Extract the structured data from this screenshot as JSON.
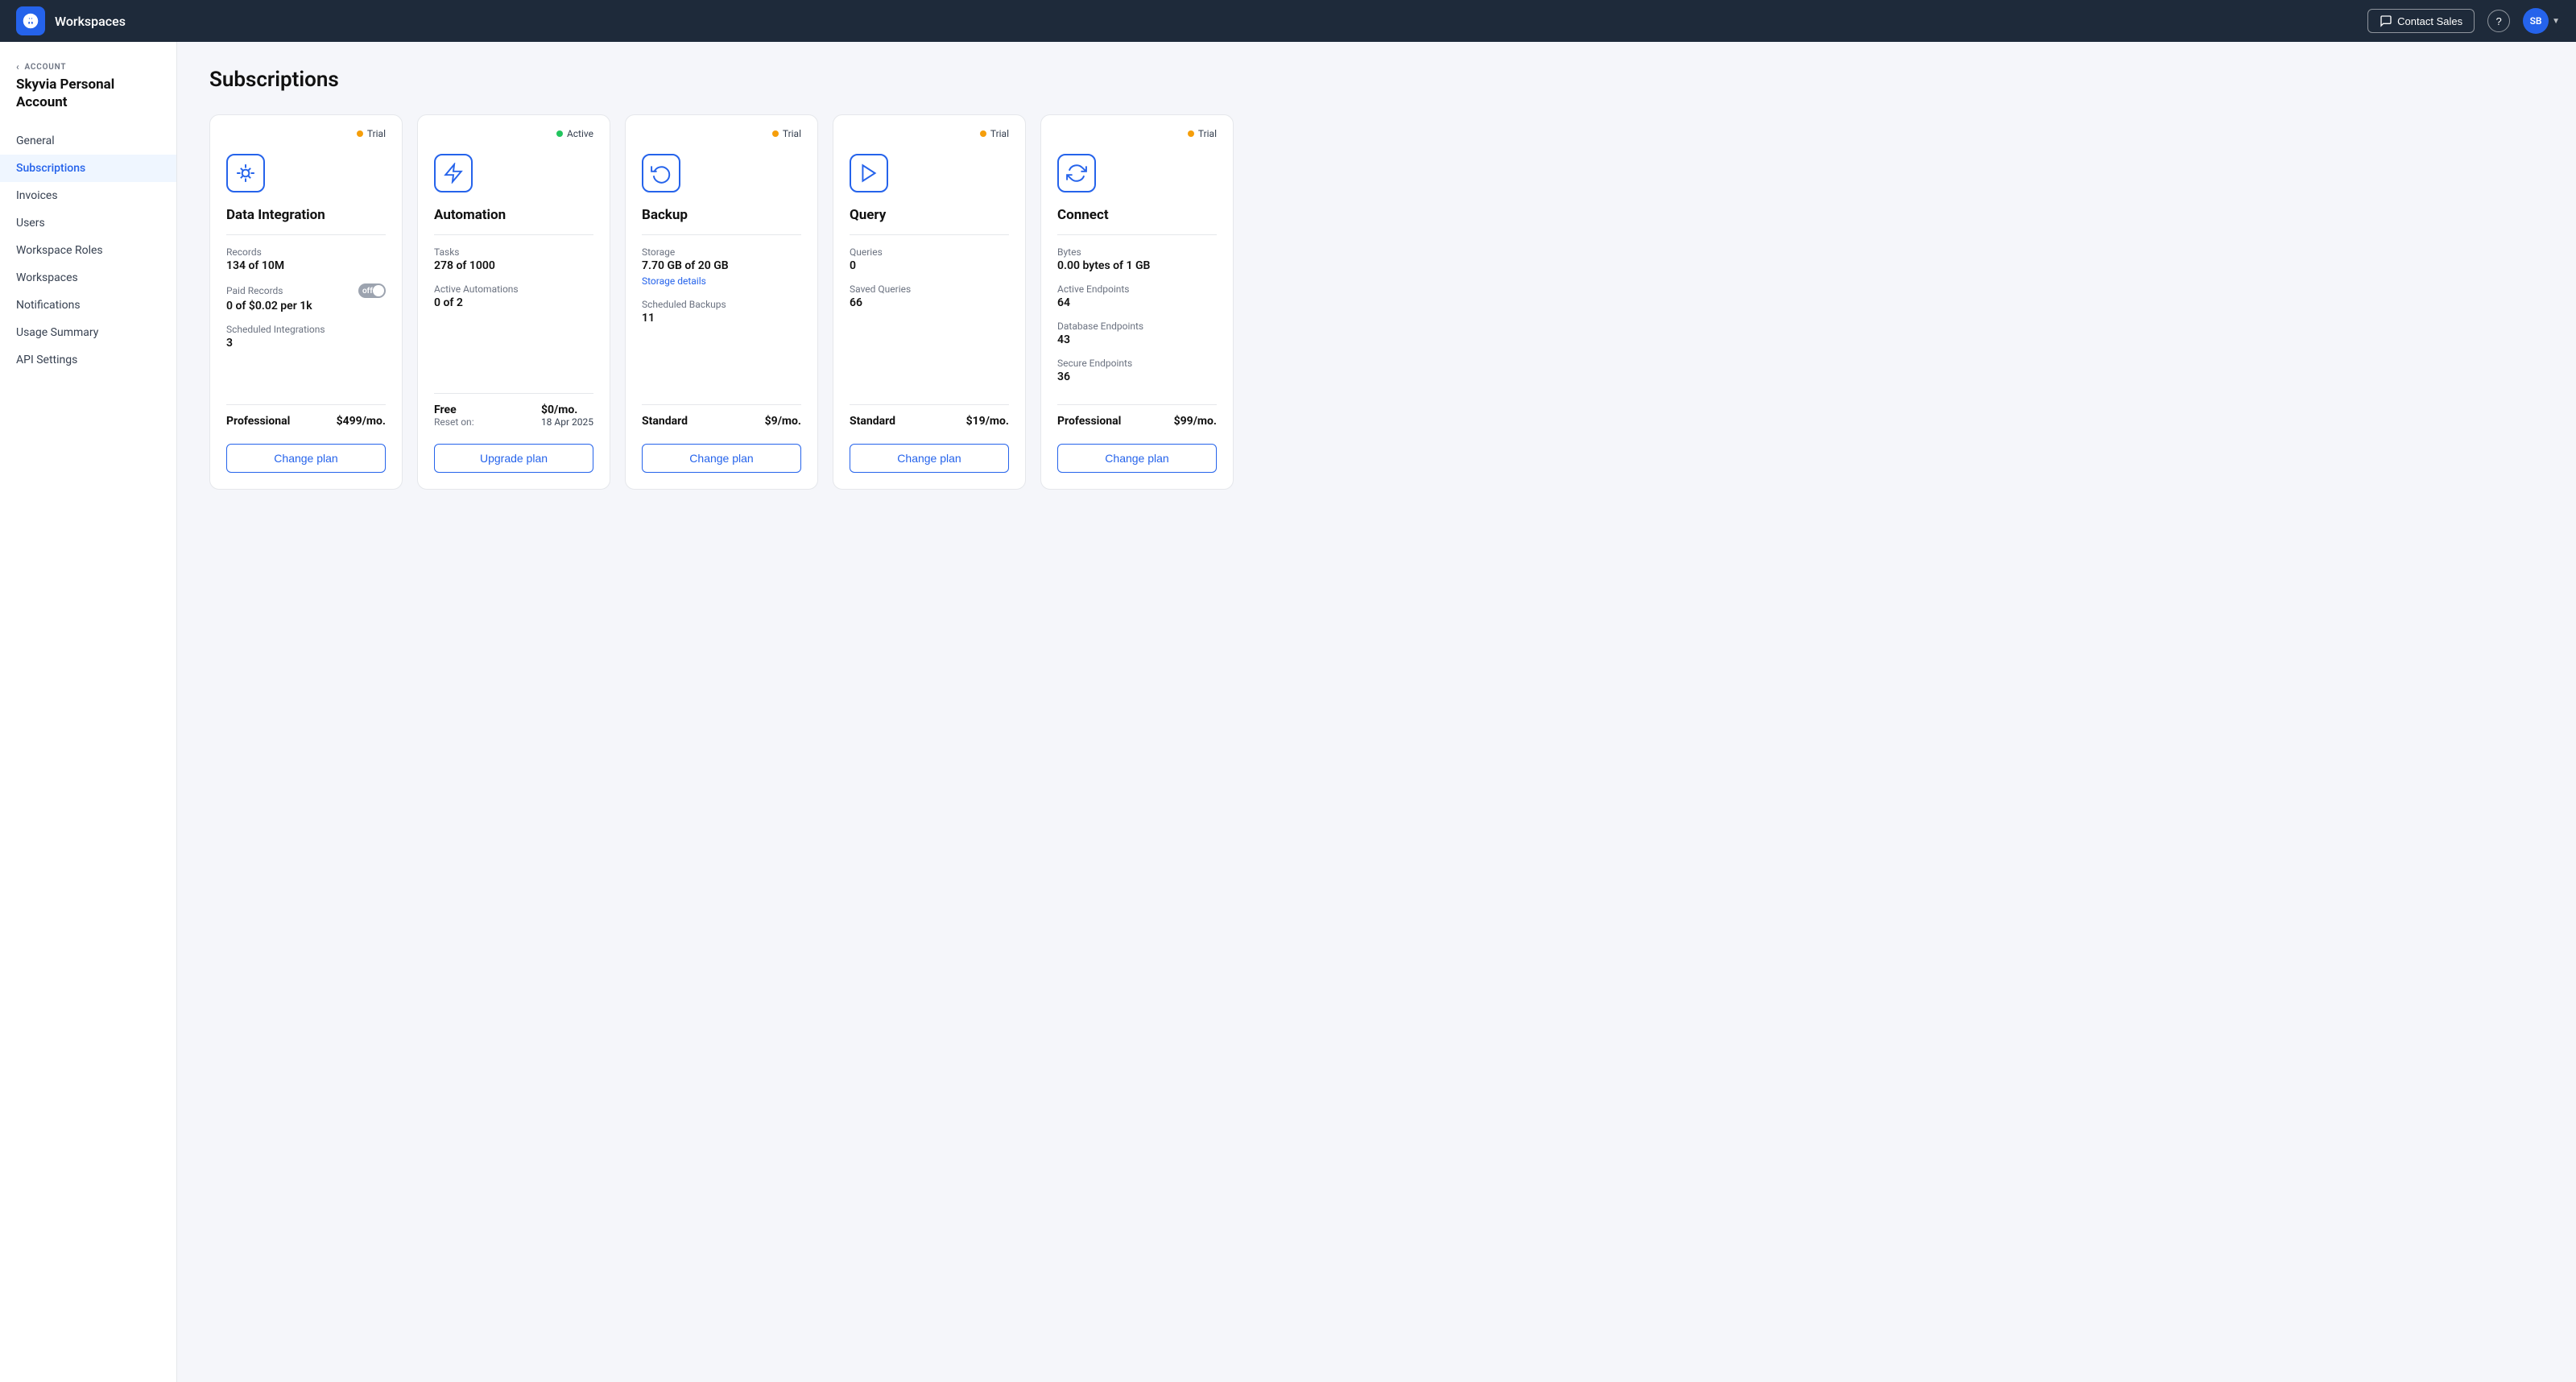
{
  "app": {
    "logo_alt": "Skyvia logo",
    "title": "Workspaces",
    "contact_sales": "Contact Sales",
    "help_label": "?",
    "user_initials": "SB"
  },
  "sidebar": {
    "account_label": "ACCOUNT",
    "workspace_name": "Skyvia Personal Account",
    "nav_items": [
      {
        "id": "general",
        "label": "General",
        "active": false
      },
      {
        "id": "subscriptions",
        "label": "Subscriptions",
        "active": true
      },
      {
        "id": "invoices",
        "label": "Invoices",
        "active": false
      },
      {
        "id": "users",
        "label": "Users",
        "active": false
      },
      {
        "id": "workspace-roles",
        "label": "Workspace Roles",
        "active": false
      },
      {
        "id": "workspaces",
        "label": "Workspaces",
        "active": false
      },
      {
        "id": "notifications",
        "label": "Notifications",
        "active": false
      },
      {
        "id": "usage-summary",
        "label": "Usage Summary",
        "active": false
      },
      {
        "id": "api-settings",
        "label": "API Settings",
        "active": false
      }
    ]
  },
  "main": {
    "page_title": "Subscriptions",
    "cards": [
      {
        "id": "data-integration",
        "status": "Trial",
        "status_type": "trial",
        "icon": "data-integration-icon",
        "service_name": "Data Integration",
        "stats": [
          {
            "label": "Records",
            "value": "134 of 10M",
            "type": "plain"
          },
          {
            "label": "Paid Records",
            "value": "0 of $0.02 per 1k",
            "type": "toggle",
            "toggle_state": "off"
          },
          {
            "label": "Scheduled Integrations",
            "value": "3",
            "type": "plain"
          }
        ],
        "plan_name": "Professional",
        "plan_price": "$499/mo.",
        "plan_reset": null,
        "plan_reset_date": null,
        "action_label": "Change plan"
      },
      {
        "id": "automation",
        "status": "Active",
        "status_type": "active",
        "icon": "automation-icon",
        "service_name": "Automation",
        "stats": [
          {
            "label": "Tasks",
            "value": "278 of 1000",
            "type": "plain"
          },
          {
            "label": "Active Automations",
            "value": "0 of 2",
            "type": "plain"
          }
        ],
        "plan_name": "Free",
        "plan_price": "$0/mo.",
        "plan_reset": "Reset on:",
        "plan_reset_date": "18 Apr 2025",
        "action_label": "Upgrade plan"
      },
      {
        "id": "backup",
        "status": "Trial",
        "status_type": "trial",
        "icon": "backup-icon",
        "service_name": "Backup",
        "stats": [
          {
            "label": "Storage",
            "value": "7.70 GB of 20 GB",
            "type": "plain",
            "link": "Storage details"
          },
          {
            "label": "Scheduled Backups",
            "value": "11",
            "type": "plain"
          }
        ],
        "plan_name": "Standard",
        "plan_price": "$9/mo.",
        "plan_reset": null,
        "plan_reset_date": null,
        "action_label": "Change plan"
      },
      {
        "id": "query",
        "status": "Trial",
        "status_type": "trial",
        "icon": "query-icon",
        "service_name": "Query",
        "stats": [
          {
            "label": "Queries",
            "value": "0",
            "type": "plain"
          },
          {
            "label": "Saved Queries",
            "value": "66",
            "type": "plain"
          }
        ],
        "plan_name": "Standard",
        "plan_price": "$19/mo.",
        "plan_reset": null,
        "plan_reset_date": null,
        "action_label": "Change plan"
      },
      {
        "id": "connect",
        "status": "Trial",
        "status_type": "trial",
        "icon": "connect-icon",
        "service_name": "Connect",
        "stats": [
          {
            "label": "Bytes",
            "value": "0.00 bytes of 1 GB",
            "type": "plain"
          },
          {
            "label": "Active Endpoints",
            "value": "64",
            "type": "plain"
          },
          {
            "label": "Database Endpoints",
            "value": "43",
            "type": "plain"
          },
          {
            "label": "Secure Endpoints",
            "value": "36",
            "type": "plain"
          }
        ],
        "plan_name": "Professional",
        "plan_price": "$99/mo.",
        "plan_reset": null,
        "plan_reset_date": null,
        "action_label": "Change plan"
      }
    ]
  }
}
